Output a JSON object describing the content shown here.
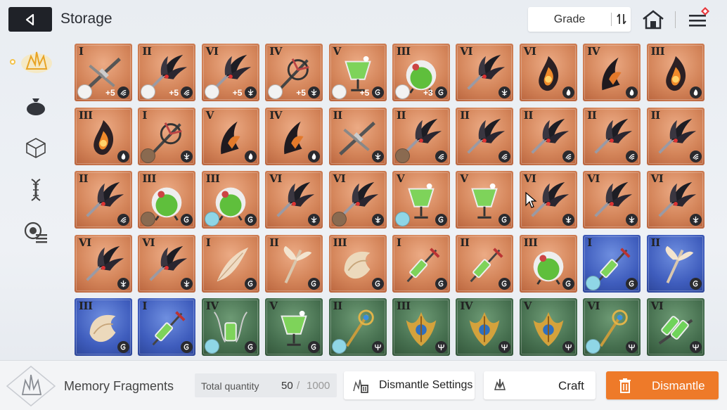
{
  "header": {
    "title": "Storage",
    "grade_label": "Grade"
  },
  "sidebar": {
    "items": [
      {
        "name": "memory-fragments",
        "icon": "crystal-icon",
        "active": true
      },
      {
        "name": "materials",
        "icon": "bag-icon",
        "active": false
      },
      {
        "name": "boxes",
        "icon": "cube-icon",
        "active": false
      },
      {
        "name": "genes",
        "icon": "dna-icon",
        "active": false
      },
      {
        "name": "others",
        "icon": "list-badge-icon",
        "active": false
      }
    ]
  },
  "colors": {
    "accent_orange": "#ee7a29",
    "rarity_orange": "#d4855a",
    "rarity_blue": "#3f5dbd",
    "rarity_green": "#466f4f"
  },
  "grid": {
    "items": [
      {
        "grade": "I",
        "rarity": "orange",
        "item": "crossbow",
        "element": "wind",
        "avatar": "white",
        "level": "+5"
      },
      {
        "grade": "II",
        "rarity": "orange",
        "item": "claw",
        "element": "wind",
        "avatar": "white",
        "level": "+5"
      },
      {
        "grade": "VI",
        "rarity": "orange",
        "item": "claw",
        "element": "blade",
        "avatar": "white",
        "level": "+5"
      },
      {
        "grade": "IV",
        "rarity": "orange",
        "item": "spiked-staff",
        "element": "blade",
        "avatar": "white",
        "level": "+5"
      },
      {
        "grade": "V",
        "rarity": "orange",
        "item": "potion-glass",
        "element": "swirl",
        "avatar": "white",
        "level": "+5"
      },
      {
        "grade": "III",
        "rarity": "orange",
        "item": "flask",
        "element": "swirl",
        "avatar": "white",
        "level": "+3"
      },
      {
        "grade": "VI",
        "rarity": "orange",
        "item": "claw",
        "element": "blade",
        "avatar": "",
        "level": ""
      },
      {
        "grade": "VI",
        "rarity": "orange",
        "item": "flame-crystal",
        "element": "flame",
        "avatar": "",
        "level": ""
      },
      {
        "grade": "IV",
        "rarity": "orange",
        "item": "flame-claw",
        "element": "flame",
        "avatar": "",
        "level": ""
      },
      {
        "grade": "III",
        "rarity": "orange",
        "item": "flame-crystal",
        "element": "flame",
        "avatar": "",
        "level": ""
      },
      {
        "grade": "III",
        "rarity": "orange",
        "item": "flame-crystal",
        "element": "flame",
        "avatar": "",
        "level": ""
      },
      {
        "grade": "I",
        "rarity": "orange",
        "item": "spiked-staff",
        "element": "blade",
        "avatar": "brown",
        "level": ""
      },
      {
        "grade": "V",
        "rarity": "orange",
        "item": "flame-claw",
        "element": "flame",
        "avatar": "",
        "level": ""
      },
      {
        "grade": "IV",
        "rarity": "orange",
        "item": "flame-claw",
        "element": "flame",
        "avatar": "",
        "level": ""
      },
      {
        "grade": "II",
        "rarity": "orange",
        "item": "crossbow",
        "element": "blade",
        "avatar": "",
        "level": ""
      },
      {
        "grade": "II",
        "rarity": "orange",
        "item": "claw",
        "element": "wind",
        "avatar": "brown",
        "level": ""
      },
      {
        "grade": "II",
        "rarity": "orange",
        "item": "claw",
        "element": "wind",
        "avatar": "",
        "level": ""
      },
      {
        "grade": "II",
        "rarity": "orange",
        "item": "claw",
        "element": "wind",
        "avatar": "",
        "level": ""
      },
      {
        "grade": "II",
        "rarity": "orange",
        "item": "claw",
        "element": "wind",
        "avatar": "",
        "level": ""
      },
      {
        "grade": "II",
        "rarity": "orange",
        "item": "claw",
        "element": "wind",
        "avatar": "",
        "level": ""
      },
      {
        "grade": "II",
        "rarity": "orange",
        "item": "claw",
        "element": "wind",
        "avatar": "",
        "level": ""
      },
      {
        "grade": "III",
        "rarity": "orange",
        "item": "flask",
        "element": "swirl",
        "avatar": "brown",
        "level": ""
      },
      {
        "grade": "III",
        "rarity": "orange",
        "item": "flask",
        "element": "swirl",
        "avatar": "teal",
        "level": ""
      },
      {
        "grade": "VI",
        "rarity": "orange",
        "item": "claw",
        "element": "blade",
        "avatar": "",
        "level": ""
      },
      {
        "grade": "VI",
        "rarity": "orange",
        "item": "claw",
        "element": "blade",
        "avatar": "brown",
        "level": ""
      },
      {
        "grade": "V",
        "rarity": "orange",
        "item": "potion-glass",
        "element": "swirl",
        "avatar": "teal",
        "level": ""
      },
      {
        "grade": "V",
        "rarity": "orange",
        "item": "potion-glass",
        "element": "swirl",
        "avatar": "",
        "level": ""
      },
      {
        "grade": "VI",
        "rarity": "orange",
        "item": "claw",
        "element": "blade",
        "avatar": "",
        "level": ""
      },
      {
        "grade": "VI",
        "rarity": "orange",
        "item": "claw",
        "element": "blade",
        "avatar": "",
        "level": ""
      },
      {
        "grade": "VI",
        "rarity": "orange",
        "item": "claw",
        "element": "blade",
        "avatar": "",
        "level": ""
      },
      {
        "grade": "VI",
        "rarity": "orange",
        "item": "claw",
        "element": "blade",
        "avatar": "",
        "level": ""
      },
      {
        "grade": "VI",
        "rarity": "orange",
        "item": "claw",
        "element": "blade",
        "avatar": "",
        "level": ""
      },
      {
        "grade": "I",
        "rarity": "orange",
        "item": "feather",
        "element": "swirl",
        "avatar": "",
        "level": ""
      },
      {
        "grade": "II",
        "rarity": "orange",
        "item": "feather-staff",
        "element": "swirl",
        "avatar": "",
        "level": ""
      },
      {
        "grade": "III",
        "rarity": "orange",
        "item": "shell",
        "element": "swirl",
        "avatar": "",
        "level": ""
      },
      {
        "grade": "I",
        "rarity": "orange",
        "item": "syringe",
        "element": "swirl",
        "avatar": "",
        "level": ""
      },
      {
        "grade": "II",
        "rarity": "orange",
        "item": "syringe",
        "element": "swirl",
        "avatar": "",
        "level": ""
      },
      {
        "grade": "III",
        "rarity": "orange",
        "item": "flask",
        "element": "swirl",
        "avatar": "",
        "level": ""
      },
      {
        "grade": "I",
        "rarity": "blue",
        "item": "syringe",
        "element": "swirl",
        "avatar": "teal",
        "level": ""
      },
      {
        "grade": "II",
        "rarity": "blue",
        "item": "feather-staff",
        "element": "swirl",
        "avatar": "",
        "level": ""
      },
      {
        "grade": "III",
        "rarity": "blue",
        "item": "shell",
        "element": "swirl",
        "avatar": "",
        "level": ""
      },
      {
        "grade": "I",
        "rarity": "blue",
        "item": "syringe",
        "element": "swirl",
        "avatar": "",
        "level": ""
      },
      {
        "grade": "IV",
        "rarity": "green",
        "item": "chain-vial",
        "element": "swirl",
        "avatar": "teal",
        "level": ""
      },
      {
        "grade": "V",
        "rarity": "green",
        "item": "potion-glass",
        "element": "swirl",
        "avatar": "",
        "level": ""
      },
      {
        "grade": "II",
        "rarity": "green",
        "item": "golden-staff",
        "element": "trident",
        "avatar": "teal",
        "level": ""
      },
      {
        "grade": "III",
        "rarity": "green",
        "item": "golden-crest",
        "element": "trident",
        "avatar": "",
        "level": ""
      },
      {
        "grade": "IV",
        "rarity": "green",
        "item": "golden-crest",
        "element": "trident",
        "avatar": "",
        "level": ""
      },
      {
        "grade": "V",
        "rarity": "green",
        "item": "golden-crest",
        "element": "trident",
        "avatar": "",
        "level": ""
      },
      {
        "grade": "VI",
        "rarity": "green",
        "item": "golden-staff",
        "element": "trident",
        "avatar": "teal",
        "level": ""
      },
      {
        "grade": "VI",
        "rarity": "green",
        "item": "vial-rack",
        "element": "trident",
        "avatar": "",
        "level": ""
      }
    ]
  },
  "footer": {
    "fragments_label": "Memory Fragments",
    "total_quantity_label": "Total quantity",
    "quantity": "50",
    "slash": "/",
    "quantity_max": "1000",
    "dismantle_settings_label": "Dismantle Settings",
    "craft_label": "Craft",
    "dismantle_label": "Dismantle"
  }
}
